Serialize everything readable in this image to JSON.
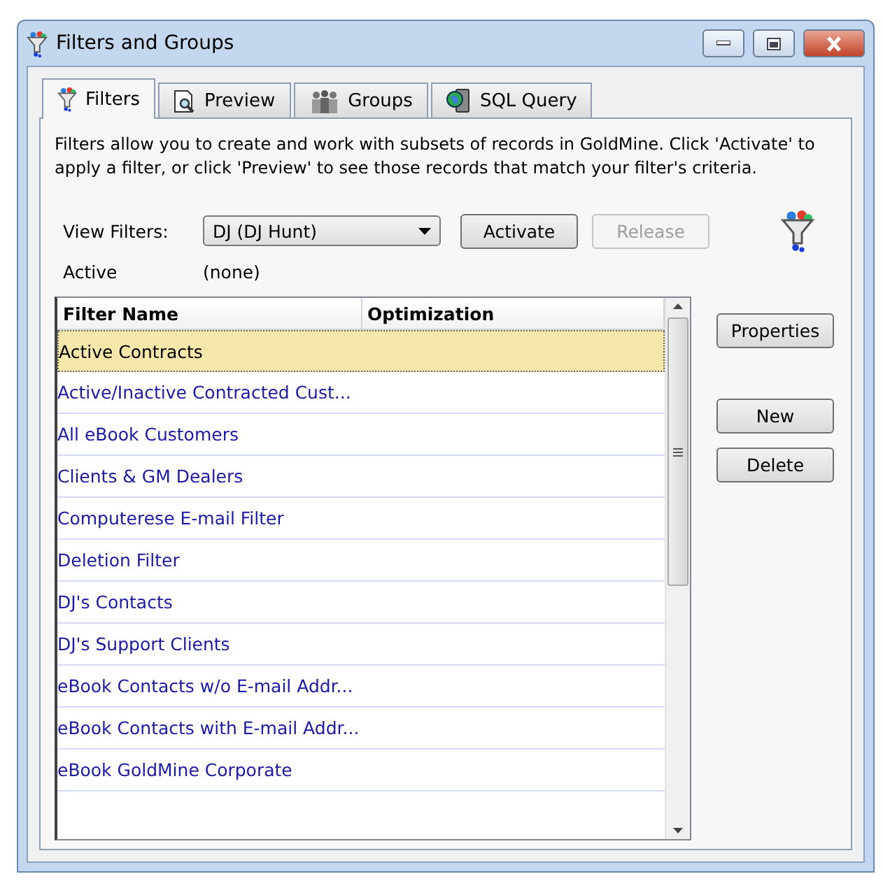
{
  "window": {
    "title": "Filters and Groups"
  },
  "tabs": [
    {
      "label": "Filters",
      "selected": true
    },
    {
      "label": "Preview",
      "selected": false
    },
    {
      "label": "Groups",
      "selected": false
    },
    {
      "label": "SQL Query",
      "selected": false
    }
  ],
  "description": "Filters allow you to create and work with subsets of records in GoldMine.  Click 'Activate' to apply a filter, or click 'Preview' to see those records that match your filter's criteria.",
  "view_filters": {
    "label": "View Filters:",
    "value": "DJ (DJ Hunt)"
  },
  "top_buttons": [
    {
      "label": "Activate",
      "disabled": false
    },
    {
      "label": "Release",
      "disabled": true
    }
  ],
  "active": {
    "label": "Active",
    "value": "(none)"
  },
  "table": {
    "columns": [
      "Filter Name",
      "Optimization"
    ],
    "rows": [
      {
        "name": "Active Contracts",
        "selected": true
      },
      {
        "name": "Active/Inactive Contracted Cust...",
        "selected": false
      },
      {
        "name": "All eBook Customers",
        "selected": false
      },
      {
        "name": "Clients & GM Dealers",
        "selected": false
      },
      {
        "name": "Computerese E-mail Filter",
        "selected": false
      },
      {
        "name": "Deletion Filter",
        "selected": false
      },
      {
        "name": "DJ's Contacts",
        "selected": false
      },
      {
        "name": "DJ's Support Clients",
        "selected": false
      },
      {
        "name": "eBook Contacts w/o E-mail Addr...",
        "selected": false
      },
      {
        "name": "eBook Contacts with E-mail Addr...",
        "selected": false
      },
      {
        "name": "eBook GoldMine Corporate",
        "selected": false
      }
    ]
  },
  "side_buttons": [
    {
      "label": "Properties",
      "disabled": false
    },
    {
      "label": "New",
      "disabled": false
    },
    {
      "label": "Delete",
      "disabled": false
    }
  ]
}
